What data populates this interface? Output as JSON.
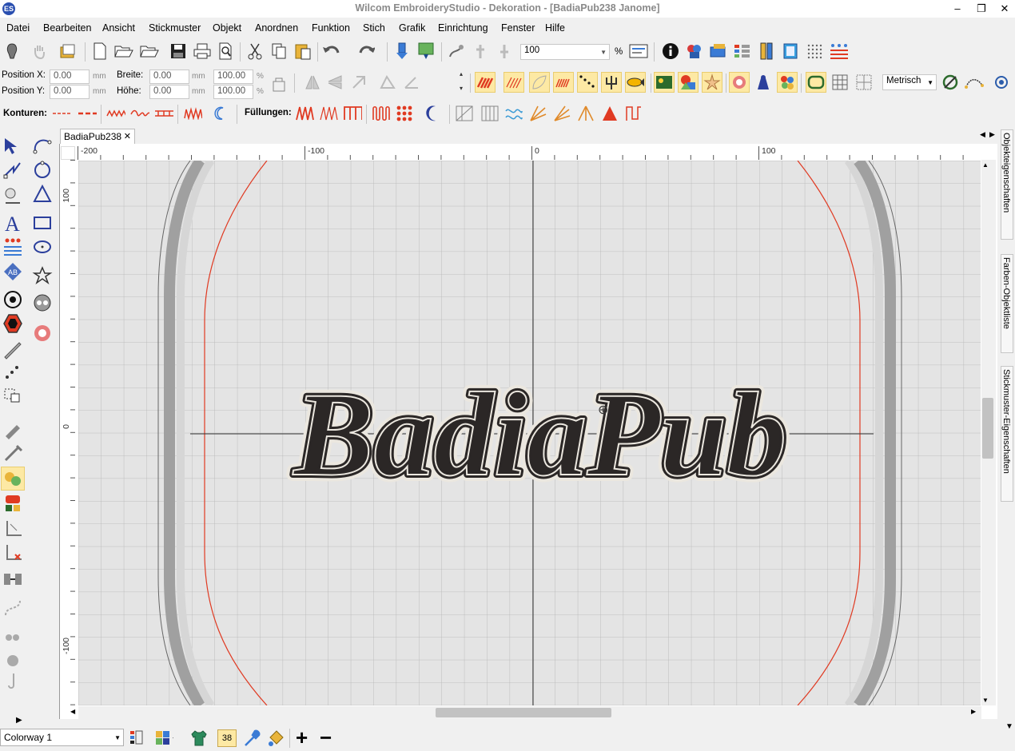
{
  "window": {
    "title": "Wilcom EmbroideryStudio - Dekoration - [BadiaPub238        Janome]",
    "app_icon": "ES",
    "minimize": "–",
    "restore": "❐",
    "close": "✕"
  },
  "menu": [
    "Datei",
    "Bearbeiten",
    "Ansicht",
    "Stickmuster",
    "Objekt",
    "Anordnen",
    "Funktion",
    "Stich",
    "Grafik",
    "Einrichtung",
    "Fenster",
    "Hilfe"
  ],
  "toolbar": {
    "zoom_value": "100",
    "zoom_unit": "%",
    "position_x_label": "Position X:",
    "position_y_label": "Position Y:",
    "position_x": "0.00",
    "position_y": "0.00",
    "width_label": "Breite:",
    "height_label": "Höhe:",
    "width": "0.00",
    "height": "0.00",
    "width_pct": "100.00",
    "height_pct": "100.00",
    "unit_mm": "mm",
    "unit_pct": "%",
    "measure_select": "Metrisch"
  },
  "stitch_bar": {
    "contours_label": "Konturen:",
    "fills_label": "Füllungen:"
  },
  "document": {
    "tab_name": "BadiaPub238",
    "tab_close": "✕",
    "design_text": "BadiaPub"
  },
  "rulers": {
    "h_labels": [
      "-200",
      "-100",
      "0",
      "100"
    ],
    "v_labels": [
      "100",
      "0",
      "-100"
    ]
  },
  "right_panel": {
    "tabs": [
      "Objekteigenschaften",
      "Farben-Objektliste",
      "Stickmuster-Eigenschaften"
    ]
  },
  "status": {
    "colorway": "Colorway 1",
    "stitch_count": "38",
    "zoom_in": "+",
    "zoom_out": "−"
  },
  "colors": {
    "accent_red": "#e03a22",
    "hoop_gray": "#a0a0a0",
    "embroidery_dark": "#2b2726",
    "embroidery_light": "#ebe7df"
  }
}
